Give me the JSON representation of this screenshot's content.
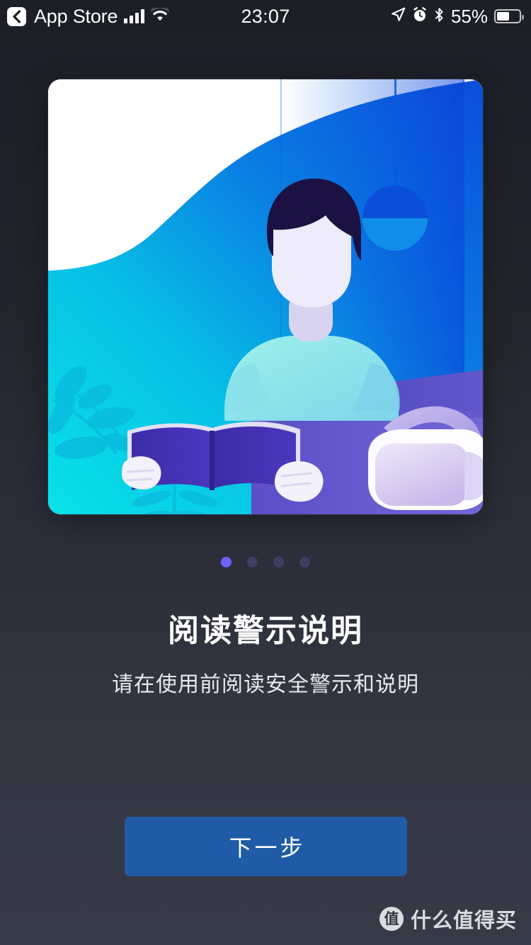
{
  "status_bar": {
    "back_label": "App Store",
    "back_icon": "chevron-left-icon",
    "signal_icon": "cellular-signal-icon",
    "signal_bars_filled": 4,
    "wifi_icon": "wifi-icon",
    "time": "23:07",
    "location_icon": "location-arrow-icon",
    "alarm_icon": "alarm-clock-icon",
    "bluetooth_icon": "bluetooth-icon",
    "battery_percent": "55%",
    "battery_level": 55,
    "battery_icon": "battery-icon"
  },
  "hero": {
    "name": "onboarding-illustration",
    "alt": "person reading a book at a desk with a VR headset",
    "colors": {
      "sky_white": "#ffffff",
      "wave_cyan": "#0ad7e8",
      "wave_blue": "#0b74e5",
      "wave_deep_blue": "#0b53db",
      "desk_purple": "#6558c8",
      "desk_purple_dark": "#4f46b8",
      "hair_navy": "#1a1140",
      "skin": "#eceaf8",
      "shirt_cyan": "#8fe5e8",
      "book_indigo": "#3f2fb0",
      "headset_white": "#fdfcff",
      "headset_lavender": "#b9aee8"
    }
  },
  "pagination": {
    "name": "onboarding-pager",
    "total": 4,
    "active_index": 0,
    "active_color": "#6c63ff",
    "inactive_color": "#403f63"
  },
  "content": {
    "headline": "阅读警示说明",
    "subhead": "请在使用前阅读安全警示和说明"
  },
  "actions": {
    "next_label": "下一步",
    "next_color": "#1f5ba6"
  },
  "watermark": {
    "badge": "值",
    "text": "什么值得买"
  }
}
